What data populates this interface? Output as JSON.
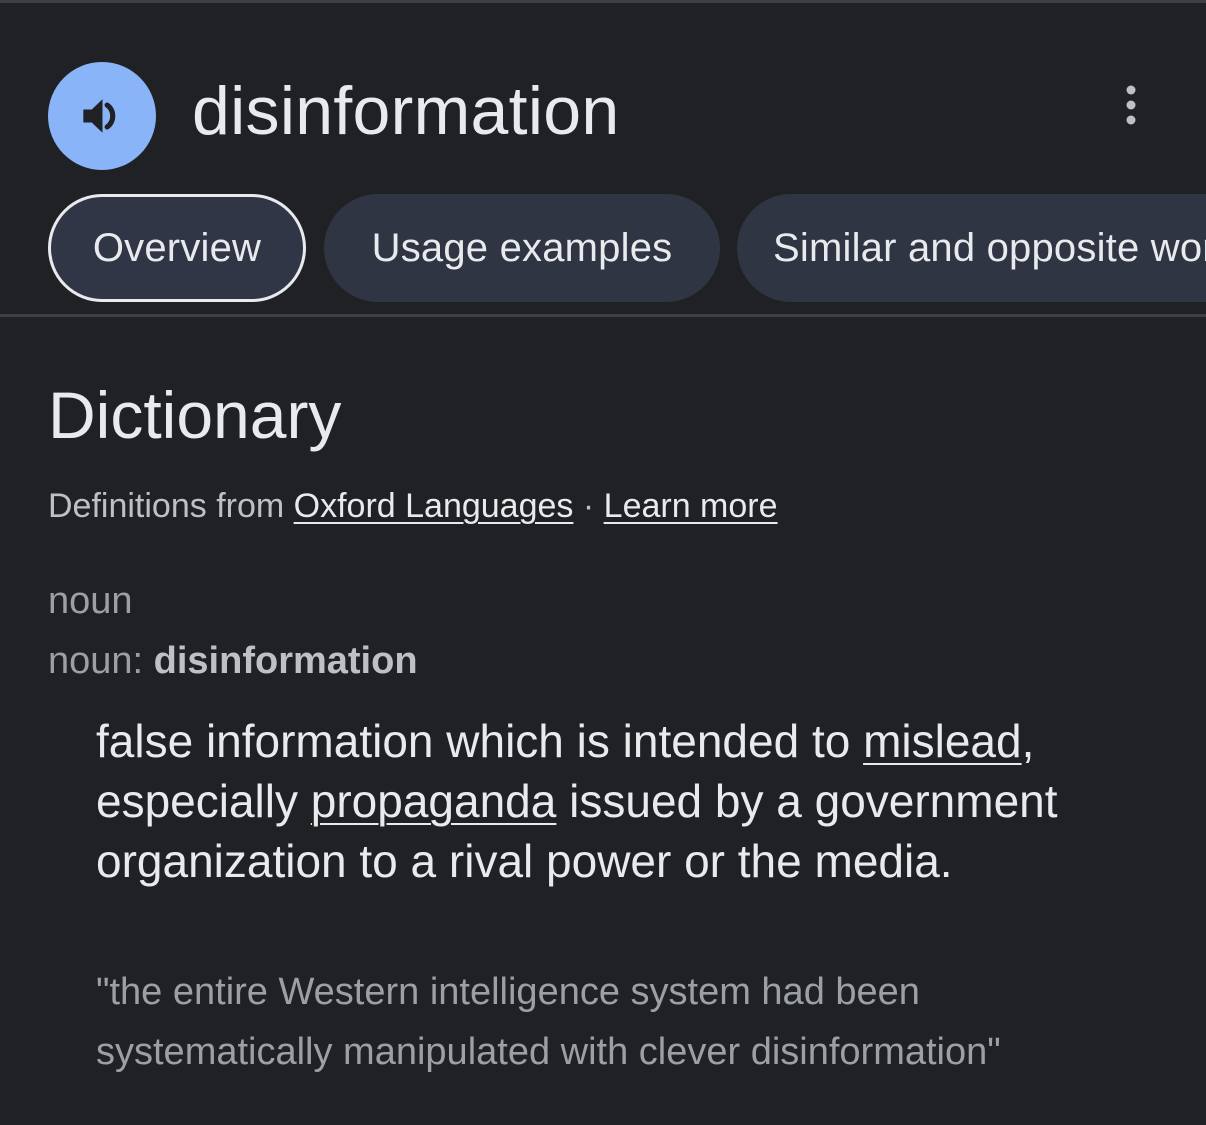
{
  "header": {
    "word": "disinformation",
    "speaker_icon": "speaker-icon",
    "more_icon": "more-vert-icon"
  },
  "tabs": [
    {
      "label": "Overview",
      "active": true
    },
    {
      "label": "Usage examples",
      "active": false
    },
    {
      "label": "Similar and opposite words",
      "active": false
    }
  ],
  "dictionary": {
    "title": "Dictionary",
    "source_prefix": "Definitions from",
    "source_link": "Oxford Languages",
    "separator": "·",
    "learn_more": "Learn more",
    "part_of_speech": "noun",
    "pos_label": "noun:",
    "pos_word": "disinformation",
    "definition": {
      "part1": "false information which is intended to",
      "link1": "mislead",
      "part2": ", especially",
      "link2": "propaganda",
      "part3": "issued by a government organization to a rival power or the media."
    },
    "example": "\"the entire Western intelligence system had been systematically manipulated with clever disinformation\""
  },
  "colors": {
    "background": "#202124",
    "accent": "#8ab4f8",
    "tab_bg": "#2f3542",
    "text": "#e8eaed",
    "muted": "#9aa0a6"
  }
}
